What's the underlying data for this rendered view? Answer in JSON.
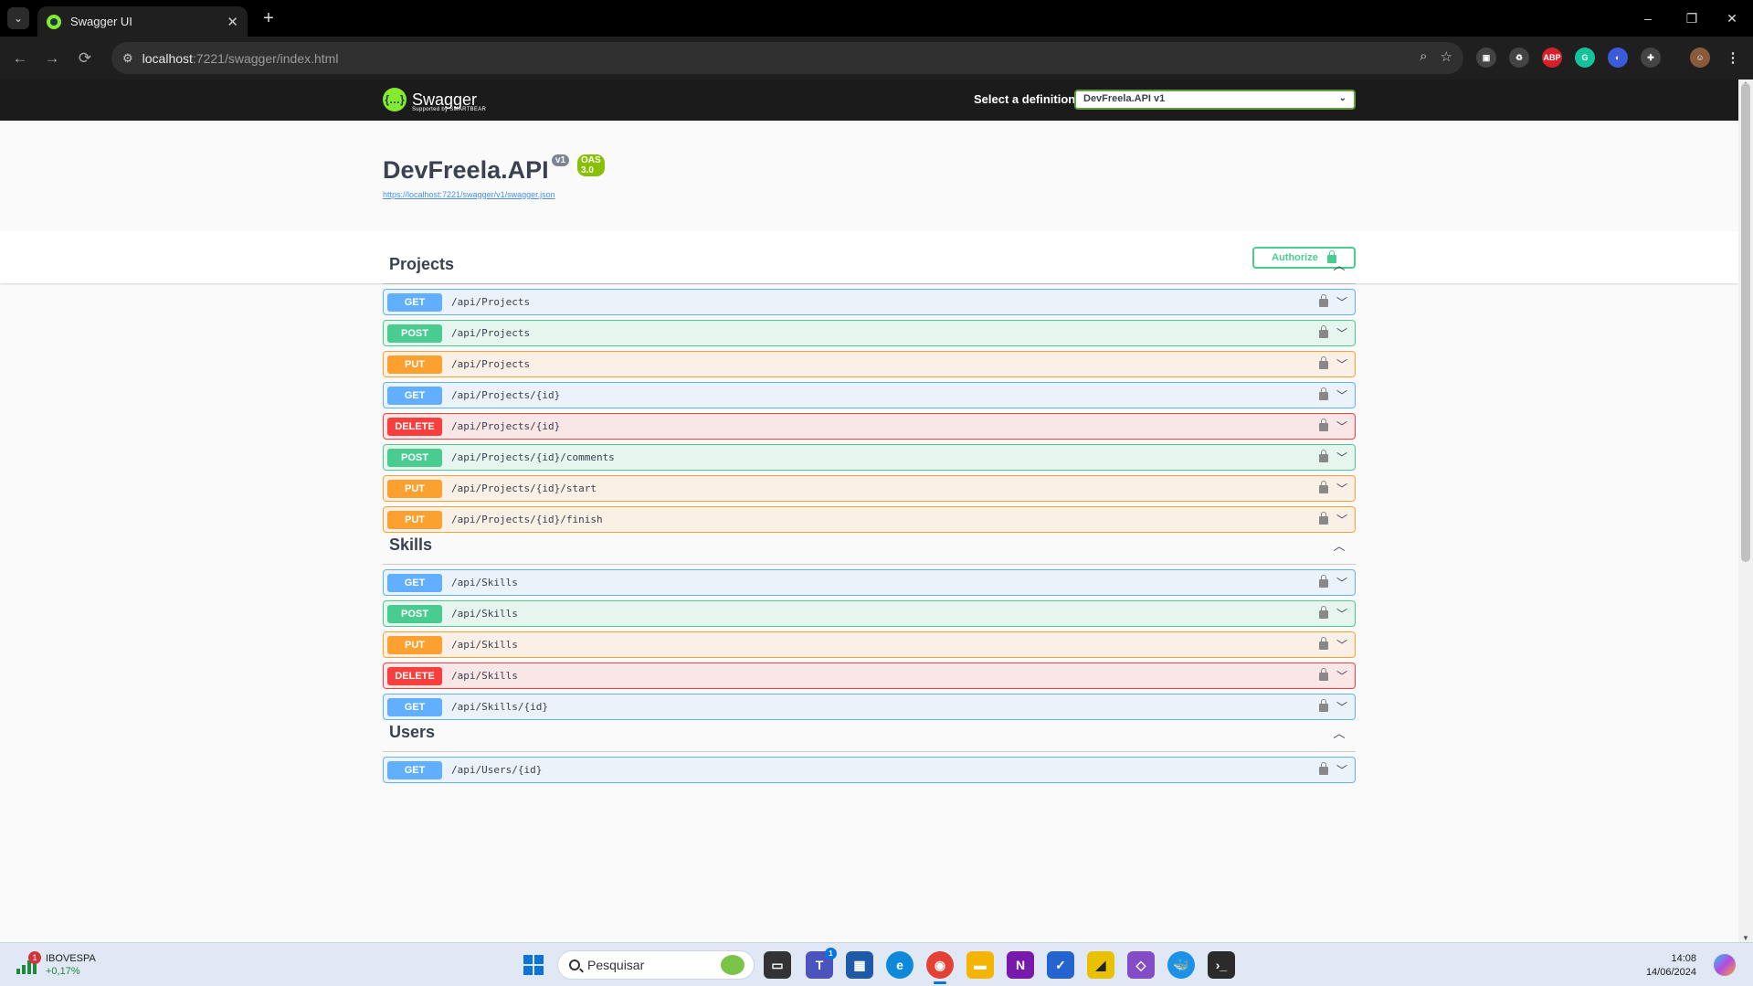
{
  "browser": {
    "tab_title": "Swagger UI",
    "tab_close": "✕",
    "new_tab": "+",
    "tab_search": "⌄",
    "url_host": "localhost",
    "url_rest": ":7221/swagger/index.html",
    "window_controls": {
      "minimize": "–",
      "restore": "❐",
      "close": "✕"
    },
    "icons": [
      "back-icon",
      "forward-icon",
      "reload-icon",
      "site-info-icon",
      "zoom-icon",
      "bookmark-star-icon",
      "screenshot-icon",
      "extension-icon",
      "adblock-icon",
      "grammarly-icon",
      "extension-blue-icon",
      "puzzle-icon",
      "profile-avatar",
      "menu-dots-icon"
    ]
  },
  "swagger": {
    "brand": "Swagger",
    "brand_sub": "Supported by SMARTBEAR",
    "definition_label": "Select a definition",
    "definition_selected": "DevFreela.API v1",
    "api_title": "DevFreela.API",
    "version_badge": "v1",
    "oas_badge": "OAS 3.0",
    "spec_url": "https://localhost:7221/swagger/v1/swagger.json",
    "authorize_label": "Authorize",
    "colors": {
      "get": "#61affe",
      "post": "#49cc90",
      "put": "#fca130",
      "delete": "#f93e3e",
      "topbar": "#1b1b1b"
    },
    "tags": [
      {
        "name": "Projects",
        "operations": [
          {
            "method": "GET",
            "path": "/api/Projects"
          },
          {
            "method": "POST",
            "path": "/api/Projects"
          },
          {
            "method": "PUT",
            "path": "/api/Projects"
          },
          {
            "method": "GET",
            "path": "/api/Projects/{id}"
          },
          {
            "method": "DELETE",
            "path": "/api/Projects/{id}"
          },
          {
            "method": "POST",
            "path": "/api/Projects/{id}/comments"
          },
          {
            "method": "PUT",
            "path": "/api/Projects/{id}/start"
          },
          {
            "method": "PUT",
            "path": "/api/Projects/{id}/finish"
          }
        ]
      },
      {
        "name": "Skills",
        "operations": [
          {
            "method": "GET",
            "path": "/api/Skills"
          },
          {
            "method": "POST",
            "path": "/api/Skills"
          },
          {
            "method": "PUT",
            "path": "/api/Skills"
          },
          {
            "method": "DELETE",
            "path": "/api/Skills"
          },
          {
            "method": "GET",
            "path": "/api/Skills/{id}"
          }
        ]
      },
      {
        "name": "Users",
        "operations": [
          {
            "method": "GET",
            "path": "/api/Users/{id}"
          }
        ]
      }
    ]
  },
  "taskbar": {
    "widget_badge": "1",
    "widget_name": "IBOVESPA",
    "widget_delta": "+0,17%",
    "search_placeholder": "Pesquisar",
    "teams_badge": "1",
    "time": "14:08",
    "date": "14/06/2024",
    "apps": [
      "file-explorer-icon",
      "teams-icon",
      "store-icon",
      "edge-icon",
      "chrome-icon",
      "folder-icon",
      "onenote-icon",
      "todo-icon",
      "sticky-notes-icon",
      "visual-studio-icon",
      "docker-icon",
      "terminal-icon"
    ]
  }
}
